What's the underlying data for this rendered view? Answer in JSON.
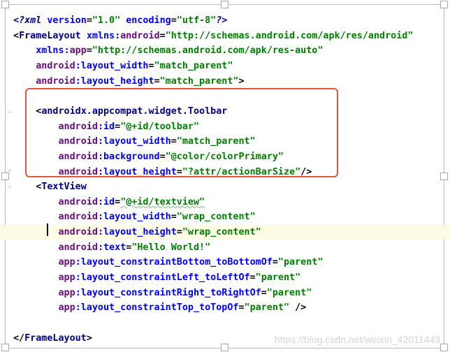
{
  "editor": {
    "lines": [
      {
        "parts": [
          {
            "t": "<?",
            "c": "pi"
          },
          {
            "t": "xml",
            "c": "pi"
          },
          {
            "t": " ",
            "c": "punct"
          },
          {
            "t": "version",
            "c": "attr"
          },
          {
            "t": "=",
            "c": "punct"
          },
          {
            "t": "\"1.0\"",
            "c": "val"
          },
          {
            "t": " ",
            "c": "punct"
          },
          {
            "t": "encoding",
            "c": "attr"
          },
          {
            "t": "=",
            "c": "punct"
          },
          {
            "t": "\"utf-8\"",
            "c": "val"
          },
          {
            "t": "?>",
            "c": "pi"
          }
        ]
      },
      {
        "parts": [
          {
            "t": "<",
            "c": "punct"
          },
          {
            "t": "FrameLayout",
            "c": "tag"
          },
          {
            "t": " ",
            "c": "punct"
          },
          {
            "t": "xmlns:",
            "c": "attr"
          },
          {
            "t": "android",
            "c": "ns"
          },
          {
            "t": "=",
            "c": "punct"
          },
          {
            "t": "\"http://schemas.android.com/apk/res/android\"",
            "c": "val"
          }
        ]
      },
      {
        "parts": [
          {
            "t": "    ",
            "c": "punct"
          },
          {
            "t": "xmlns:",
            "c": "attr"
          },
          {
            "t": "app",
            "c": "ns"
          },
          {
            "t": "=",
            "c": "punct"
          },
          {
            "t": "\"http://schemas.android.com/apk/res-auto\"",
            "c": "val"
          }
        ]
      },
      {
        "parts": [
          {
            "t": "    ",
            "c": "punct"
          },
          {
            "t": "android",
            "c": "ns"
          },
          {
            "t": ":layout_width",
            "c": "attr"
          },
          {
            "t": "=",
            "c": "punct"
          },
          {
            "t": "\"match_parent\"",
            "c": "val"
          }
        ]
      },
      {
        "parts": [
          {
            "t": "    ",
            "c": "punct"
          },
          {
            "t": "android",
            "c": "ns"
          },
          {
            "t": ":layout_height",
            "c": "attr"
          },
          {
            "t": "=",
            "c": "punct"
          },
          {
            "t": "\"match_parent\"",
            "c": "val"
          },
          {
            "t": ">",
            "c": "punct"
          }
        ]
      },
      {
        "parts": []
      },
      {
        "parts": [
          {
            "t": "    <",
            "c": "punct"
          },
          {
            "t": "androidx.appcompat.widget.Toolbar",
            "c": "tag"
          }
        ]
      },
      {
        "parts": [
          {
            "t": "        ",
            "c": "punct"
          },
          {
            "t": "android",
            "c": "ns"
          },
          {
            "t": ":id",
            "c": "attr"
          },
          {
            "t": "=",
            "c": "punct"
          },
          {
            "t": "\"@+id/toolbar\"",
            "c": "val"
          }
        ]
      },
      {
        "parts": [
          {
            "t": "        ",
            "c": "punct"
          },
          {
            "t": "android",
            "c": "ns"
          },
          {
            "t": ":layout_width",
            "c": "attr"
          },
          {
            "t": "=",
            "c": "punct"
          },
          {
            "t": "\"match_parent\"",
            "c": "val"
          }
        ]
      },
      {
        "parts": [
          {
            "t": "        ",
            "c": "punct"
          },
          {
            "t": "android",
            "c": "ns"
          },
          {
            "t": ":background",
            "c": "attr"
          },
          {
            "t": "=",
            "c": "punct"
          },
          {
            "t": "\"@color/colorPrimary\"",
            "c": "val"
          }
        ]
      },
      {
        "parts": [
          {
            "t": "        ",
            "c": "punct"
          },
          {
            "t": "android",
            "c": "ns"
          },
          {
            "t": ":layout_height",
            "c": "attr"
          },
          {
            "t": "=",
            "c": "punct"
          },
          {
            "t": "\"?attr/actionBarSize\"",
            "c": "val"
          },
          {
            "t": "/>",
            "c": "punct"
          }
        ]
      },
      {
        "parts": [
          {
            "t": "    <",
            "c": "punct"
          },
          {
            "t": "TextView",
            "c": "tag"
          }
        ]
      },
      {
        "parts": [
          {
            "t": "        ",
            "c": "punct"
          },
          {
            "t": "android",
            "c": "ns"
          },
          {
            "t": ":id",
            "c": "attr"
          },
          {
            "t": "=",
            "c": "punct"
          },
          {
            "t": "\"@+id/textview\"",
            "c": "val",
            "squiggle": true
          }
        ]
      },
      {
        "parts": [
          {
            "t": "        ",
            "c": "punct"
          },
          {
            "t": "android",
            "c": "ns"
          },
          {
            "t": ":layout_width",
            "c": "attr"
          },
          {
            "t": "=",
            "c": "punct"
          },
          {
            "t": "\"wrap_content\"",
            "c": "val"
          }
        ]
      },
      {
        "parts": [
          {
            "t": "        ",
            "c": "punct"
          },
          {
            "t": "android",
            "c": "ns"
          },
          {
            "t": ":layout_height",
            "c": "attr"
          },
          {
            "t": "=",
            "c": "punct"
          },
          {
            "t": "\"wrap_content\"",
            "c": "val"
          }
        ],
        "current": true
      },
      {
        "parts": [
          {
            "t": "        ",
            "c": "punct"
          },
          {
            "t": "android",
            "c": "ns"
          },
          {
            "t": ":text",
            "c": "attr"
          },
          {
            "t": "=",
            "c": "punct"
          },
          {
            "t": "\"Hello World!\"",
            "c": "val"
          }
        ]
      },
      {
        "parts": [
          {
            "t": "        ",
            "c": "punct"
          },
          {
            "t": "app",
            "c": "ns"
          },
          {
            "t": ":layout_constraintBottom_toBottomOf",
            "c": "attr"
          },
          {
            "t": "=",
            "c": "punct"
          },
          {
            "t": "\"parent\"",
            "c": "val"
          }
        ]
      },
      {
        "parts": [
          {
            "t": "        ",
            "c": "punct"
          },
          {
            "t": "app",
            "c": "ns"
          },
          {
            "t": ":layout_constraintLeft_toLeftOf",
            "c": "attr"
          },
          {
            "t": "=",
            "c": "punct"
          },
          {
            "t": "\"parent\"",
            "c": "val"
          }
        ]
      },
      {
        "parts": [
          {
            "t": "        ",
            "c": "punct"
          },
          {
            "t": "app",
            "c": "ns"
          },
          {
            "t": ":layout_constraintRight_toRightOf",
            "c": "attr"
          },
          {
            "t": "=",
            "c": "punct"
          },
          {
            "t": "\"parent\"",
            "c": "val"
          }
        ]
      },
      {
        "parts": [
          {
            "t": "        ",
            "c": "punct"
          },
          {
            "t": "app",
            "c": "ns"
          },
          {
            "t": ":layout_constraintTop_toTopOf",
            "c": "attr"
          },
          {
            "t": "=",
            "c": "punct"
          },
          {
            "t": "\"parent\"",
            "c": "val"
          },
          {
            "t": " />",
            "c": "punct"
          }
        ]
      },
      {
        "parts": []
      },
      {
        "parts": [
          {
            "t": "</",
            "c": "punct"
          },
          {
            "t": "FrameLayout",
            "c": "tag"
          },
          {
            "t": ">",
            "c": "punct"
          }
        ]
      }
    ]
  },
  "watermark": "https://blog.csdn.net/weixin_42011443",
  "colors": {
    "highlight_box": "#e8533a",
    "current_line": "#fdfbe4"
  }
}
